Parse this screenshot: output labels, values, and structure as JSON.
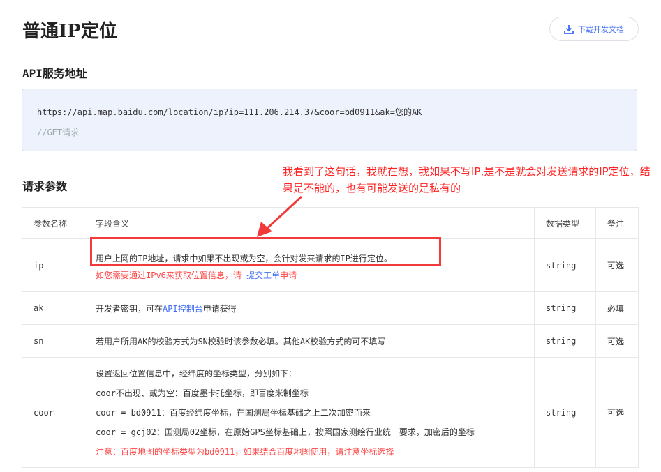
{
  "title": "普通IP定位",
  "download_label": "下载开发文档",
  "api_section": "API服务地址",
  "api_url": "https://api.map.baidu.com/location/ip?ip=111.206.214.37&coor=bd0911&ak=您的AK",
  "api_comment": "//GET请求",
  "params_section": "请求参数",
  "annotation": "我看到了这句话，我就在想，我如果不写IP,是不是就会对发送请求的IP定位，结果是不能的，也有可能发送的是私有的",
  "headers": [
    "参数名称",
    "字段含义",
    "数据类型",
    "备注"
  ],
  "rows": {
    "ip": {
      "name": "ip",
      "desc": "用户上网的IP地址，请求中如果不出现或为空，会针对发来请求的IP进行定位。",
      "note_pre": "如您需要通过IPv6来获取位置信息，请 ",
      "note_link": "提交工单",
      "note_post": "申请",
      "type": "string",
      "remark": "可选"
    },
    "ak": {
      "name": "ak",
      "desc_pre": "开发者密钥，可在",
      "desc_link": "API控制台",
      "desc_post": "申请获得",
      "type": "string",
      "remark": "必填"
    },
    "sn": {
      "name": "sn",
      "desc": "若用户所用AK的校验方式为SN校验时该参数必填。其他AK校验方式的可不填写",
      "type": "string",
      "remark": "可选"
    },
    "coor": {
      "name": "coor",
      "lines": [
        "设置返回位置信息中，经纬度的坐标类型，分别如下：",
        "coor不出现、或为空：百度墨卡托坐标，即百度米制坐标",
        "coor = bd0911：百度经纬度坐标，在国测局坐标基础之上二次加密而来",
        "coor = gcj02：国测局02坐标，在原始GPS坐标基础上，按照国家测绘行业统一要求，加密后的坐标"
      ],
      "warning": "注意：百度地图的坐标类型为bd0911，如果结合百度地图使用，请注意坐标选择",
      "type": "string",
      "remark": "可选"
    }
  },
  "colors": {
    "accent": "#3d6cf5",
    "annotation": "#f23a3a"
  }
}
